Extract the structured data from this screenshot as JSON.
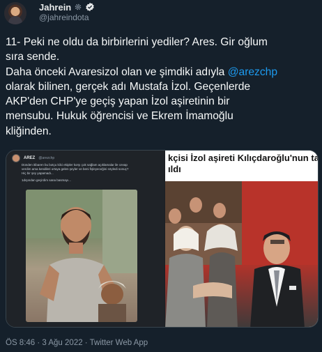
{
  "author": {
    "display_name": "Jahrein",
    "handle": "@jahreindota"
  },
  "tweet": {
    "lines": [
      "11- Peki ne oldu da birbirlerini yediler? Ares. Gir oğlum",
      "sıra sende.",
      "Daha önceki Avaresizol olan ve şimdiki adıyla ",
      "olarak bilinen, gerçek adı Mustafa İzol. Geçenlerde",
      "AKP'den CHP'ye geçiş yapan İzol aşiretinin bir",
      "mensubu. Hukuk öğrencisi ve Ekrem İmamoğlu",
      "kliğinden."
    ],
    "mention": "@arezchp"
  },
  "media": {
    "embedded_tweet": {
      "name": "AREZ",
      "handle": "@arezchp",
      "text": "Dünden itibaren bu botçu kilci ekipler korşı çok sağlam açıklamalar ile cevap verdim ama kendileri ortaya gelen şeyler ve beni fişleyeceğini söyledi sonuç? Hiç bir şey yapamadı...",
      "text2": "1dışından geçirdim sana basmayı..."
    },
    "headline": [
      "kçisi İzol aşireti Kılıçdaroğlu'nun ta",
      "ıldı"
    ]
  },
  "footer": {
    "meta": "ÖS 8:46 · 3 Ağu 2022 · Twitter Web App"
  },
  "colors": {
    "background": "#15202b",
    "link": "#1d9bf0",
    "secondary_text": "#8b98a5",
    "verified": "#1d9bf0"
  }
}
